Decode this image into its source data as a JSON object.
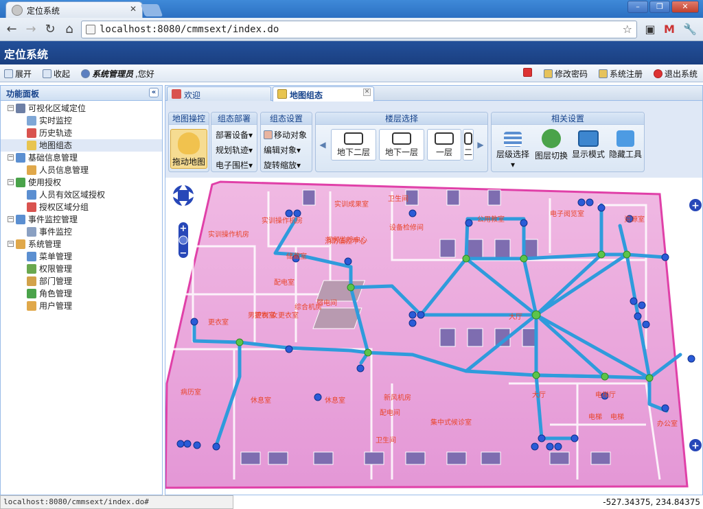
{
  "browser": {
    "tab_title": "定位系统",
    "tab_close": "✕",
    "url": "localhost:8080/cmmsext/index.do",
    "win_min": "–",
    "win_max": "❐",
    "win_close": "✕"
  },
  "app": {
    "title": "定位系统",
    "toolbar": {
      "expand": "展开",
      "collapse": "收起",
      "user_role": "系统管理员",
      "greeting": ",您好",
      "change_password": "修改密码",
      "system_register": "系统注册",
      "logout": "退出系统"
    }
  },
  "sidebar": {
    "title": "功能面板",
    "collapse": "«",
    "nodes": [
      {
        "label": "可视化区域定位",
        "expanded": "−"
      },
      {
        "label": "实时监控"
      },
      {
        "label": "历史轨迹"
      },
      {
        "label": "地图组态"
      },
      {
        "label": "基础信息管理",
        "expanded": "−"
      },
      {
        "label": "人员信息管理"
      },
      {
        "label": "使用授权",
        "expanded": "−"
      },
      {
        "label": "人员有效区域授权"
      },
      {
        "label": "授权区域分组"
      },
      {
        "label": "事件监控管理",
        "expanded": "−"
      },
      {
        "label": "事件监控"
      },
      {
        "label": "系统管理",
        "expanded": "−"
      },
      {
        "label": "菜单管理"
      },
      {
        "label": "权限管理"
      },
      {
        "label": "部门管理"
      },
      {
        "label": "角色管理"
      },
      {
        "label": "用户管理"
      }
    ]
  },
  "tabs": [
    {
      "label": "欢迎"
    },
    {
      "label": "地图组态",
      "close": "✕"
    }
  ],
  "ribbon": {
    "map_ops": {
      "title": "地图操控",
      "drag": "拖动地图"
    },
    "deploy": {
      "title": "组态部署",
      "items": [
        "部署设备▾",
        "规划轨迹▾",
        "电子围栏▾"
      ]
    },
    "settings": {
      "title": "组态设置",
      "items": [
        "移动对象",
        "编辑对象▾",
        "旋转缩放▾"
      ]
    },
    "floors": {
      "title": "楼层选择",
      "items": [
        "地下二层",
        "地下一层",
        "一层",
        "二"
      ],
      "prev": "◀",
      "next": "▶"
    },
    "related": {
      "title": "相关设置",
      "items": [
        "层级选择",
        "图层切换",
        "显示模式",
        "隐藏工具"
      ],
      "dropdown": "▾"
    }
  },
  "map": {
    "room_labels": [
      "实训成果室",
      "卫生间",
      "实训操作机房",
      "实训操作机房",
      "视频监控中心",
      "设备检修间",
      "公用教室",
      "电子阅览室",
      "资源室",
      "储藏室",
      "消防值控中心",
      "配电室",
      "弱电间",
      "综合机房",
      "控制室",
      "更衣室",
      "男更衣室",
      "女更衣室",
      "病历室",
      "新风机房",
      "配电间",
      "卫生间",
      "集中式候诊室",
      "大厅",
      "大厅",
      "电梯厅",
      "电梯",
      "电梯",
      "办公室",
      "休息室",
      "休息室"
    ],
    "zoom_in": "+",
    "zoom_out": "−",
    "add": "+"
  },
  "status": {
    "url": "localhost:8080/cmmsext/index.do#",
    "coords": "-527.34375, 234.84375"
  },
  "colors": {
    "header_blue": "#1a3f80",
    "panel_border": "#99bbe8",
    "floor_pink": "#e9a1d8",
    "path_blue": "#2f9bdc",
    "node_green": "#5cc44a",
    "marker_blue": "#2a5bd7"
  }
}
